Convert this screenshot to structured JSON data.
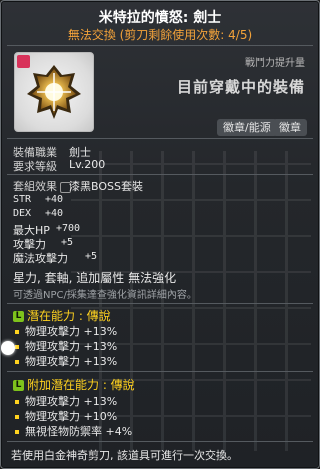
{
  "header": {
    "title": "米特拉的憤怒: 劍士",
    "subtitle": "無法交換 (剪刀剩餘使用次數: 4/5)"
  },
  "power_label": "戰鬥力提升量",
  "equipped_text": "目前穿戴中的裝備",
  "tags": [
    "徽章/能源",
    "徽章"
  ],
  "requirements": {
    "job_label": "裝備職業",
    "job_value": "劍士",
    "level_label": "要求等級",
    "level_value": "Lv.200"
  },
  "set_effect": {
    "label": "套組效果",
    "value": "漆黑BOSS套裝"
  },
  "stats": [
    {
      "label": "STR",
      "value": "+40"
    },
    {
      "label": "DEX",
      "value": "+40"
    },
    {
      "label": "最大HP",
      "value": "+700"
    },
    {
      "label": "攻擊力",
      "value": "+5"
    },
    {
      "label": "魔法攻擊力",
      "value": "+5"
    }
  ],
  "enhance_line": "星力, 套軸, 追加屬性 無法強化",
  "npc_hint": "可透過NPC/採集達查強化資訊詳細內容。",
  "potential": {
    "badge": "L",
    "title": "潛在能力 : 傳說",
    "lines": [
      "物理攻擊力 +13%",
      "物理攻擊力 +13%",
      "物理攻擊力 +13%"
    ]
  },
  "additional_potential": {
    "badge": "L",
    "title": "附加潛在能力 : 傳說",
    "lines": [
      "物理攻擊力 +13%",
      "物理攻擊力 +10%",
      "無視怪物防禦率 +4%"
    ]
  },
  "footer": "若使用白金神奇剪刀, 該道具可進行一次交換。",
  "colors": {
    "title": "#ffffff",
    "trade": "#f2a23a",
    "legendary": "#ffd21f",
    "badge": "#7ec21c"
  }
}
